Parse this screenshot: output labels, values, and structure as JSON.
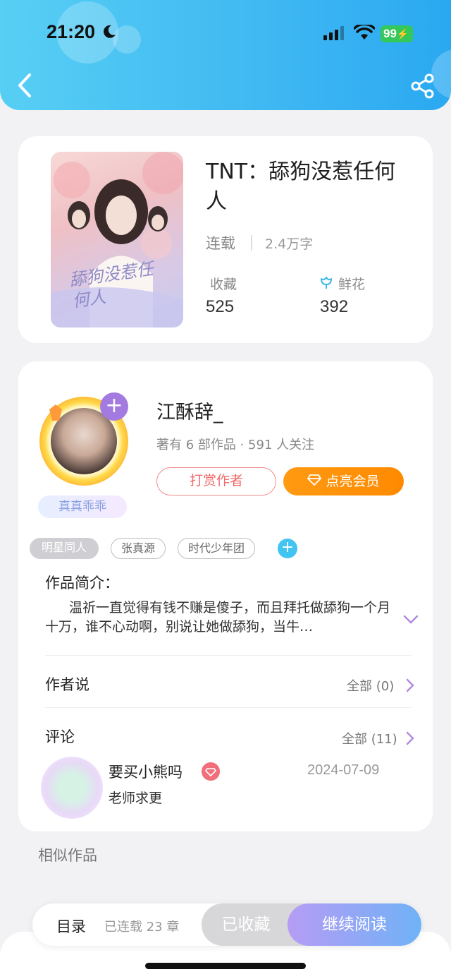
{
  "status_bar": {
    "time": "21:20",
    "battery": "99"
  },
  "book": {
    "title": "TNT：舔狗没惹任何人",
    "status": "连载",
    "word_count": "2.4万字",
    "favorites_label": "收藏",
    "favorites_value": "525",
    "flowers_label": "鲜花",
    "flowers_value": "392",
    "cover_text": "舔狗没惹任何人"
  },
  "author": {
    "name": "江酥辞_",
    "meta": "著有 6 部作品 · 591 人关注",
    "badge": "真真乖乖",
    "tip_label": "打赏作者",
    "vip_label": "点亮会员",
    "tags": [
      "明星同人",
      "张真源",
      "时代少年团"
    ]
  },
  "intro": {
    "title": "作品简介：",
    "text": "温祈一直觉得有钱不赚是傻子，而且拜托做舔狗一个月十万，谁不心动啊，别说让她做舔狗，当牛…"
  },
  "author_says": {
    "title": "作者说",
    "all_label": "全部 (0)"
  },
  "comments": {
    "title": "评论",
    "all_label": "全部 (11)",
    "items": [
      {
        "name": "要买小熊吗",
        "date": "2024-07-09",
        "text": "老师求更"
      }
    ]
  },
  "similar": {
    "title": "相似作品"
  },
  "bottom_bar": {
    "toc_label": "目录",
    "chapter_count": "已连载 23 章",
    "saved_label": "已收藏",
    "read_label": "继续阅读"
  },
  "colors": {
    "header": "#3fb7f2",
    "vip": "#ff9a12",
    "tag_add": "#42c4f2",
    "follow": "#a37ae0"
  }
}
